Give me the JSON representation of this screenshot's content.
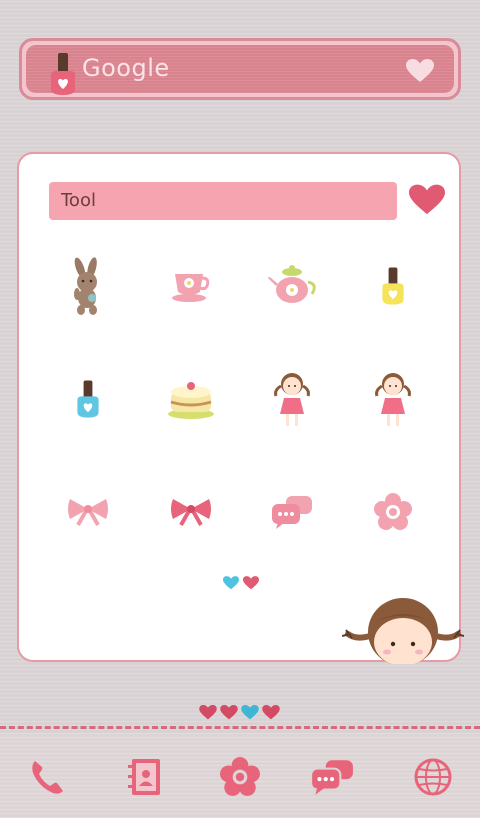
{
  "search": {
    "label": "Google"
  },
  "folder": {
    "title": "Tool",
    "apps": [
      {
        "icon": "bunny-plush-icon"
      },
      {
        "icon": "teacup-icon"
      },
      {
        "icon": "teapot-icon"
      },
      {
        "icon": "yellow-nail-polish-icon"
      },
      {
        "icon": "blue-nail-polish-icon"
      },
      {
        "icon": "cake-icon"
      },
      {
        "icon": "girl-doll-icon"
      },
      {
        "icon": "girl-doll-icon"
      },
      {
        "icon": "light-pink-bow-icon"
      },
      {
        "icon": "pink-bow-icon"
      },
      {
        "icon": "speech-bubbles-icon"
      },
      {
        "icon": "flower-icon"
      }
    ]
  },
  "dock": {
    "items": [
      {
        "icon": "phone-icon"
      },
      {
        "icon": "contacts-icon"
      },
      {
        "icon": "flower-icon"
      },
      {
        "icon": "messages-icon"
      },
      {
        "icon": "globe-icon"
      }
    ]
  },
  "colors": {
    "accent": "#d9838f",
    "heart_pink": "#e05a72",
    "heart_blue": "#4ec3df",
    "panel_border": "#e79aa7"
  }
}
